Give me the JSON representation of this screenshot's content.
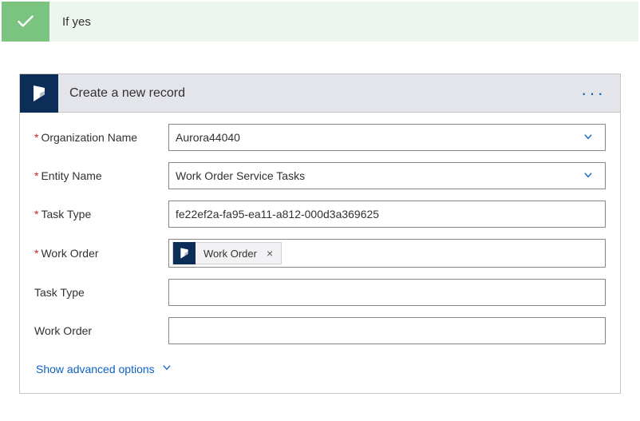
{
  "condition": {
    "title": "If yes"
  },
  "card": {
    "title": "Create a new record",
    "menu_icon": "ellipsis"
  },
  "fields": {
    "org": {
      "label": "Organization Name",
      "required": true,
      "value": "Aurora44040",
      "type": "select"
    },
    "entity": {
      "label": "Entity Name",
      "required": true,
      "value": "Work Order Service Tasks",
      "type": "select"
    },
    "task_type_req": {
      "label": "Task Type",
      "required": true,
      "value": "fe22ef2a-fa95-ea11-a812-000d3a369625",
      "type": "text"
    },
    "work_order_req": {
      "label": "Work Order",
      "required": true,
      "type": "token",
      "token": {
        "icon": "dynamics-icon",
        "label": "Work Order"
      }
    },
    "task_type": {
      "label": "Task Type",
      "required": false,
      "value": "",
      "type": "text"
    },
    "work_order": {
      "label": "Work Order",
      "required": false,
      "value": "",
      "type": "text"
    }
  },
  "advanced": {
    "label": "Show advanced options"
  }
}
